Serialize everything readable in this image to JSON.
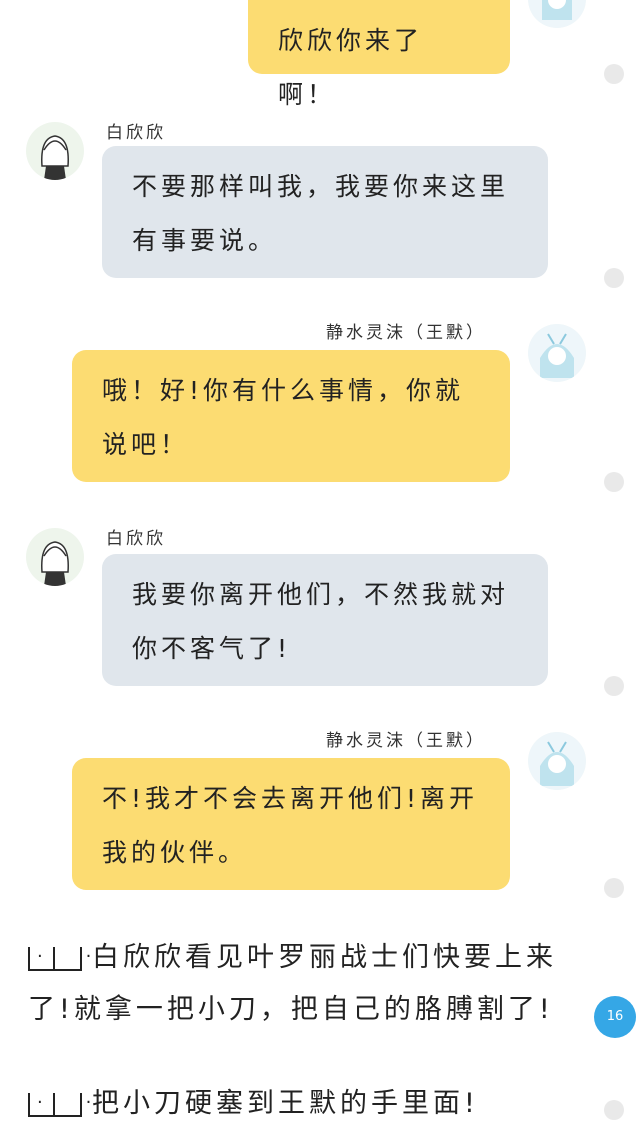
{
  "messages": [
    {
      "text": "欣欣你来了啊！"
    },
    {
      "speaker": "白欣欣",
      "text": "不要那样叫我，我要你来这里有事要说。"
    },
    {
      "speaker": "静水灵沫（王默）",
      "text": "哦！好!你有什么事情，你就说吧！"
    },
    {
      "speaker": "白欣欣",
      "text": "我要你离开他们，不然我就对你不客气了!"
    },
    {
      "speaker": "静水灵沫（王默）",
      "text": "不!我才不会去离开他们!离开我的伙伴。"
    }
  ],
  "narration": [
    {
      "text": "白欣欣看见叶罗丽战士们快要上来了!就拿一把小刀，把自己的胳膊割了!"
    },
    {
      "text": "把小刀硬塞到王默的手里面!"
    }
  ],
  "page_badge": "16",
  "colors": {
    "own_bubble": "#fcdc72",
    "other_bubble": "#e0e6ec",
    "badge": "#35a7e6"
  }
}
